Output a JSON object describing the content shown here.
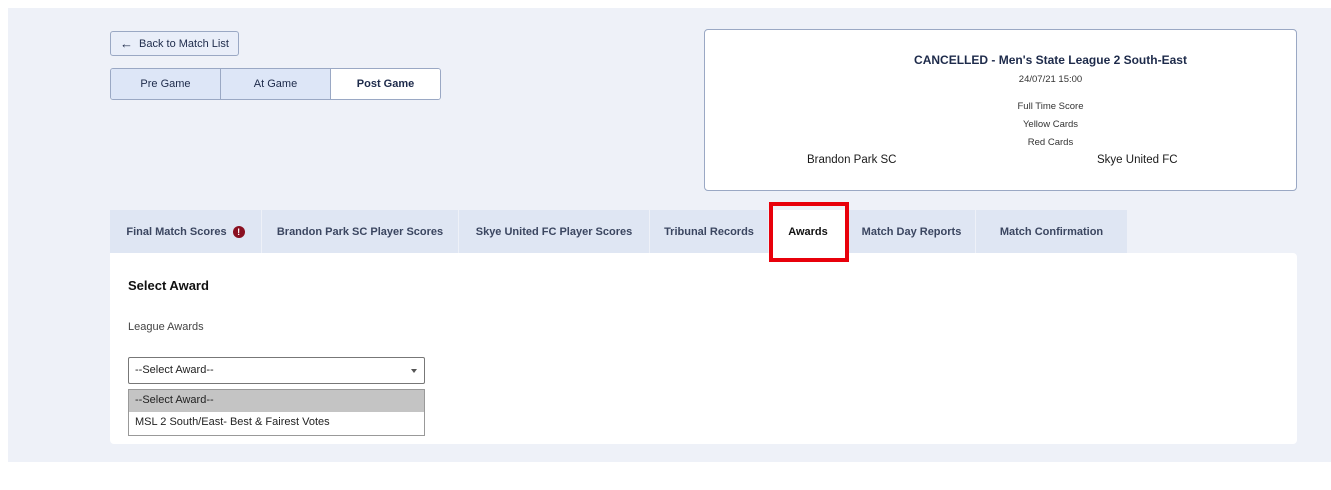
{
  "nav": {
    "back_label": "Back to Match List",
    "segments": [
      "Pre Game",
      "At Game",
      "Post Game"
    ],
    "active_segment": "Post Game"
  },
  "match": {
    "title": "CANCELLED - Men's State League 2 South-East",
    "datetime": "24/07/21 15:00",
    "rows": [
      "Full Time Score",
      "Yellow Cards",
      "Red Cards"
    ],
    "home_team": "Brandon Park SC",
    "away_team": "Skye United FC"
  },
  "tabs": [
    {
      "label": "Final Match Scores",
      "alert": "!"
    },
    {
      "label": "Brandon Park SC Player Scores"
    },
    {
      "label": "Skye United FC Player Scores"
    },
    {
      "label": "Tribunal Records"
    },
    {
      "label": "Awards",
      "active": true
    },
    {
      "label": "Match Day Reports"
    },
    {
      "label": "Match Confirmation"
    }
  ],
  "panel": {
    "title": "Select Award",
    "subtitle": "League Awards",
    "select_value": "--Select Award--",
    "options": [
      "--Select Award--",
      "MSL 2 South/East- Best & Fairest Votes"
    ]
  },
  "colors": {
    "highlight": "#e8000b",
    "alert_badge": "#8a1020",
    "page_bg": "#eef1f8"
  }
}
